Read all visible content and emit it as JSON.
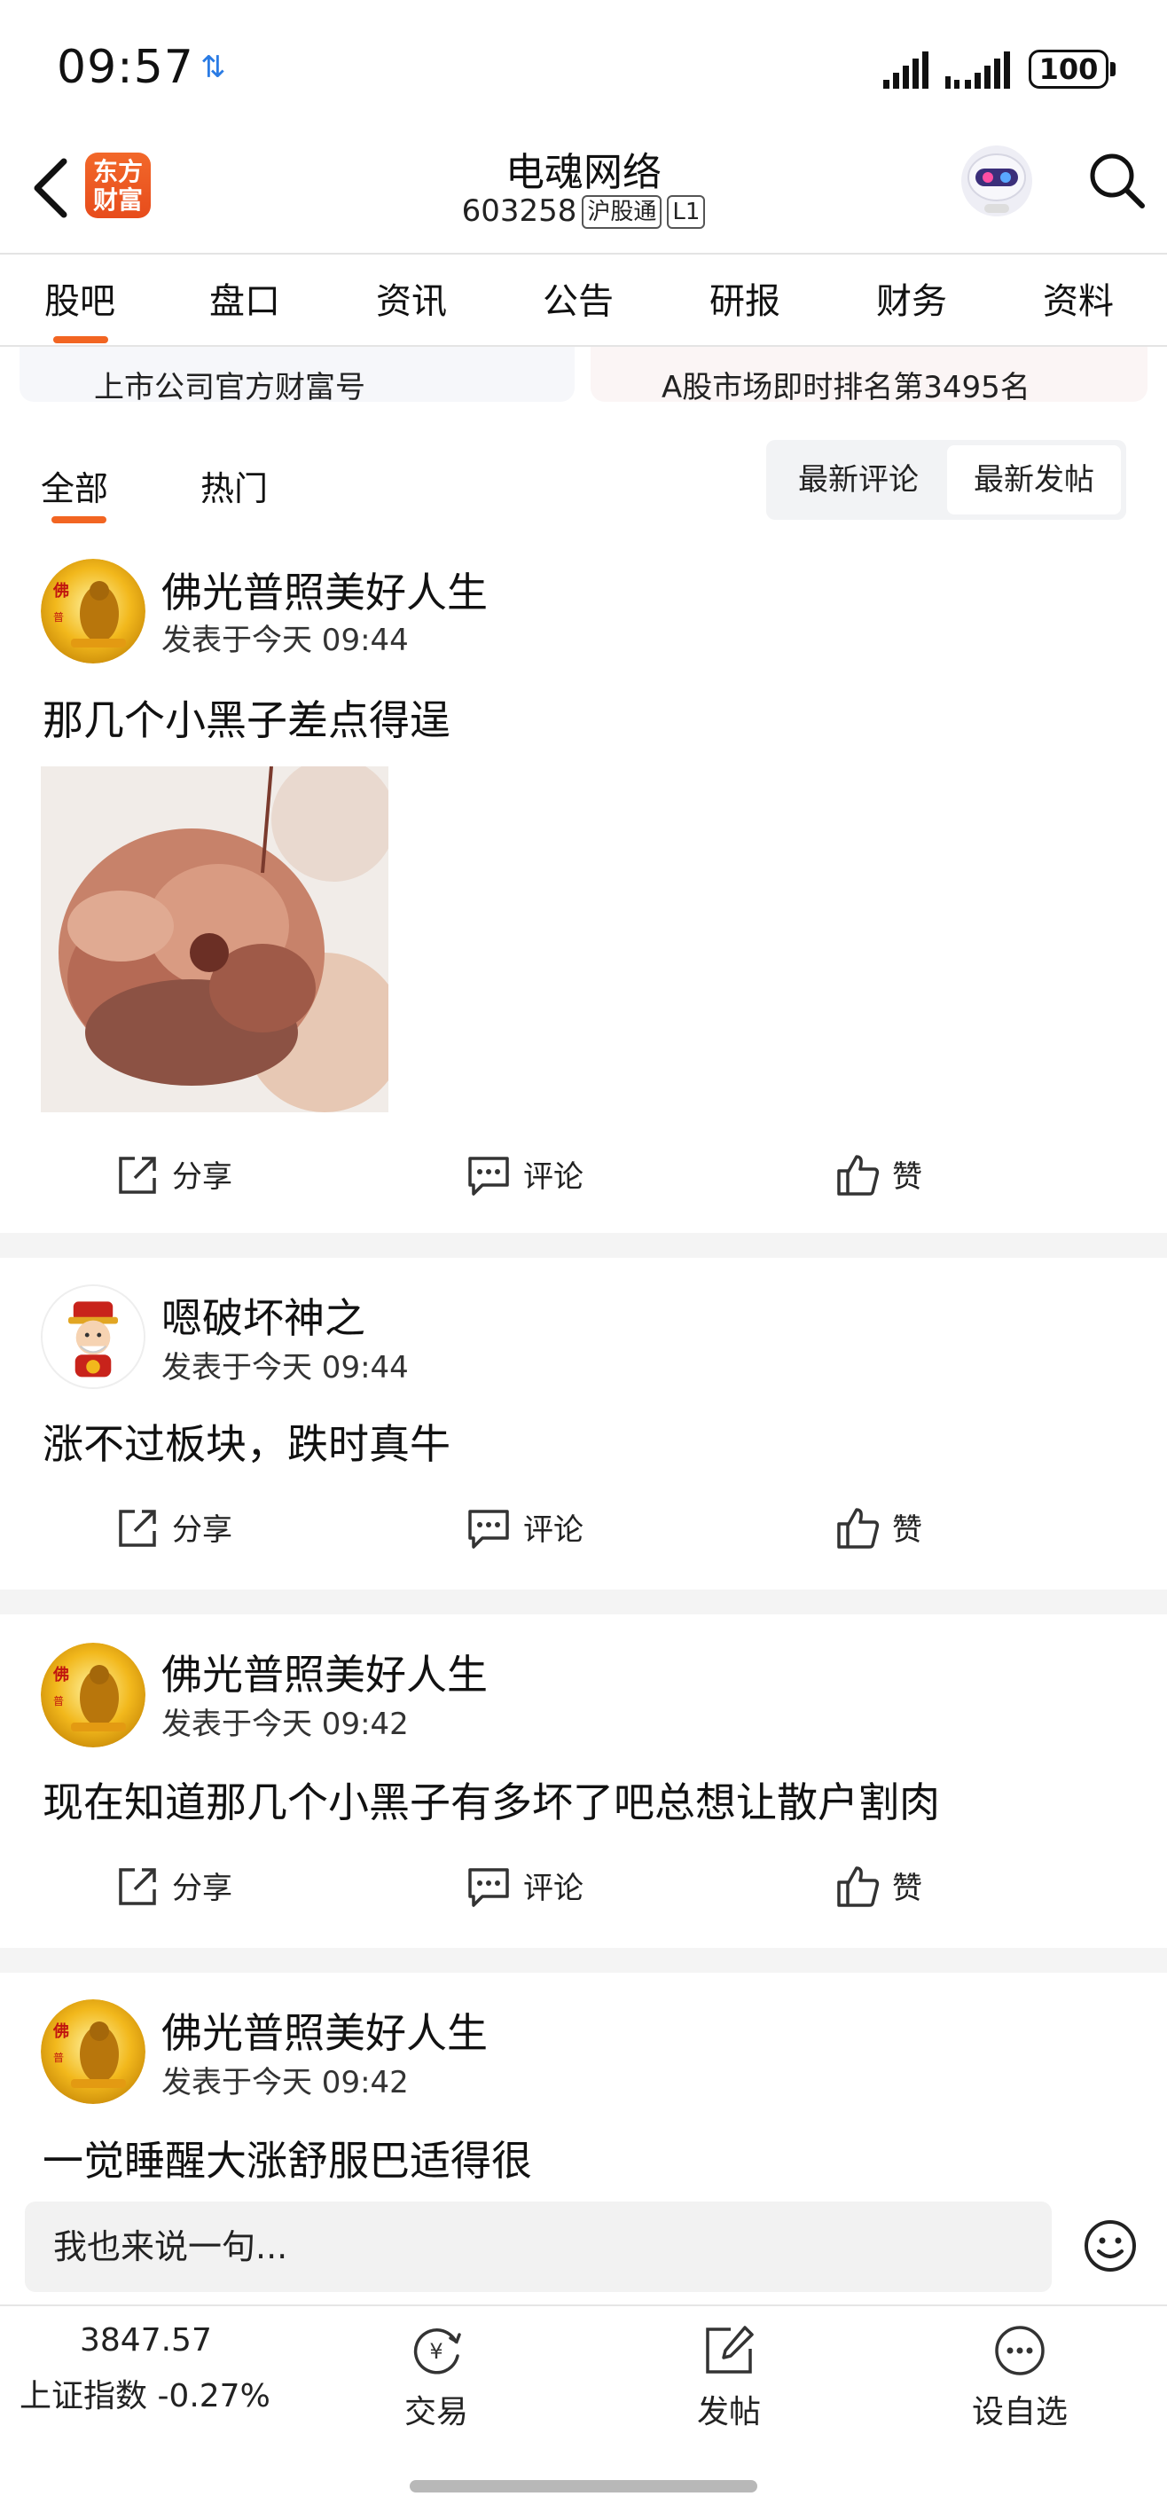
{
  "status_bar": {
    "time": "09:57",
    "carrier_icon": "signal-transfer-icon",
    "battery": "100"
  },
  "header": {
    "title": "电魂网络",
    "code": "603258",
    "tag1": "沪股通",
    "tag2": "L1",
    "logo_line1": "东方",
    "logo_line2": "财富"
  },
  "tabs": [
    "股吧",
    "盘口",
    "资讯",
    "公告",
    "研报",
    "财务",
    "资料"
  ],
  "info": {
    "left": "上市公司官方财富号",
    "right": "A股市场即时排名第3495名"
  },
  "subtabs": {
    "all": "全部",
    "hot": "热门",
    "latest_comment": "最新评论",
    "latest_post": "最新发帖"
  },
  "posts": [
    {
      "author": "佛光普照美好人生",
      "time": "发表于今天 09:44",
      "content": "那几个小黑子差点得逞"
    },
    {
      "author": "嗯破坏神之",
      "time": "发表于今天 09:44",
      "content": "涨不过板块，跌时真牛"
    },
    {
      "author": "佛光普照美好人生",
      "time": "发表于今天 09:42",
      "content": "现在知道那几个小黑子有多坏了吧总想让散户割肉"
    },
    {
      "author": "佛光普照美好人生",
      "time": "发表于今天 09:42",
      "content": "一觉睡醒大涨舒服巴适得很"
    }
  ],
  "actions": {
    "share": "分享",
    "comment": "评论",
    "like": "赞"
  },
  "input": {
    "placeholder": "我也来说一句..."
  },
  "bottom": {
    "index_value": "3847.57",
    "index_name": "上证指数 -0.27%",
    "trade": "交易",
    "post": "发帖",
    "watch": "设自选"
  },
  "colors": {
    "accent": "#f26522",
    "separator": "#f4f4f4"
  }
}
